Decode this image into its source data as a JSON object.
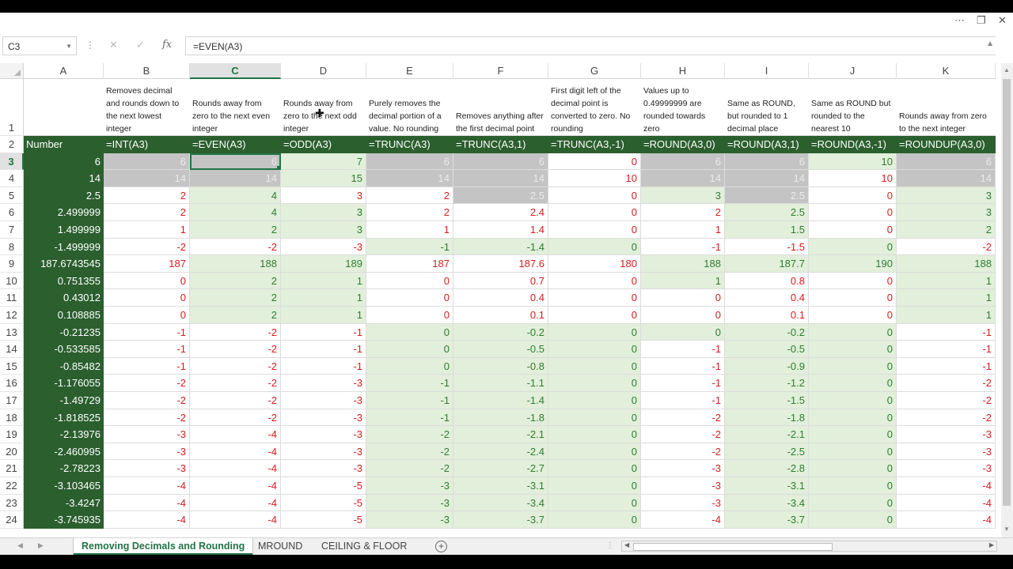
{
  "window": {
    "ribbon_dots": "⋯",
    "restore_icon": "❐",
    "close_icon": "✕"
  },
  "formula_bar": {
    "name_box": "C3",
    "cancel_icon": "✕",
    "enter_icon": "✓",
    "fx_label": "fx",
    "formula": "=EVEN(A3)"
  },
  "columns": [
    "A",
    "B",
    "C",
    "D",
    "E",
    "F",
    "G",
    "H",
    "I",
    "J",
    "K"
  ],
  "selected": {
    "col": "C",
    "row": 3
  },
  "descriptions": [
    "",
    "Removes decimal and rounds down to the next lowest integer",
    "Rounds away from zero to the next even integer",
    "Rounds away from zero to the next odd integer",
    "Purely removes the decimal portion of a value. No rounding",
    "Removes anything after the first decimal point",
    "First digit left of the decimal point is converted to zero. No rounding",
    "Values up to 0.49999999 are rounded towards zero",
    "Same as ROUND, but rounded to 1 decimal place",
    "Same as ROUND but rounded to the nearest 10",
    "Rounds away from zero to the next integer"
  ],
  "header_row": [
    "Number",
    "=INT(A3)",
    "=EVEN(A3)",
    "=ODD(A3)",
    "=TRUNC(A3)",
    "=TRUNC(A3,1)",
    "=TRUNC(A3,-1)",
    "=ROUND(A3,0)",
    "=ROUND(A3,1)",
    "=ROUND(A3,-1)",
    "=ROUNDUP(A3,0)"
  ],
  "rows": [
    [
      "6",
      "6",
      "6",
      "7",
      "6",
      "6",
      "0",
      "6",
      "6",
      "10",
      "6"
    ],
    [
      "14",
      "14",
      "14",
      "15",
      "14",
      "14",
      "10",
      "14",
      "14",
      "10",
      "14"
    ],
    [
      "2.5",
      "2",
      "4",
      "3",
      "2",
      "2.5",
      "0",
      "3",
      "2.5",
      "0",
      "3"
    ],
    [
      "2.499999",
      "2",
      "4",
      "3",
      "2",
      "2.4",
      "0",
      "2",
      "2.5",
      "0",
      "3"
    ],
    [
      "1.499999",
      "1",
      "2",
      "3",
      "1",
      "1.4",
      "0",
      "1",
      "1.5",
      "0",
      "2"
    ],
    [
      "-1.499999",
      "-2",
      "-2",
      "-3",
      "-1",
      "-1.4",
      "0",
      "-1",
      "-1.5",
      "0",
      "-2"
    ],
    [
      "187.6743545",
      "187",
      "188",
      "189",
      "187",
      "187.6",
      "180",
      "188",
      "187.7",
      "190",
      "188"
    ],
    [
      "0.751355",
      "0",
      "2",
      "1",
      "0",
      "0.7",
      "0",
      "1",
      "0.8",
      "0",
      "1"
    ],
    [
      "0.43012",
      "0",
      "2",
      "1",
      "0",
      "0.4",
      "0",
      "0",
      "0.4",
      "0",
      "1"
    ],
    [
      "0.108885",
      "0",
      "2",
      "1",
      "0",
      "0.1",
      "0",
      "0",
      "0.1",
      "0",
      "1"
    ],
    [
      "-0.21235",
      "-1",
      "-2",
      "-1",
      "0",
      "-0.2",
      "0",
      "0",
      "-0.2",
      "0",
      "-1"
    ],
    [
      "-0.533585",
      "-1",
      "-2",
      "-1",
      "0",
      "-0.5",
      "0",
      "-1",
      "-0.5",
      "0",
      "-1"
    ],
    [
      "-0.85482",
      "-1",
      "-2",
      "-1",
      "0",
      "-0.8",
      "0",
      "-1",
      "-0.9",
      "0",
      "-1"
    ],
    [
      "-1.176055",
      "-2",
      "-2",
      "-3",
      "-1",
      "-1.1",
      "0",
      "-1",
      "-1.2",
      "0",
      "-2"
    ],
    [
      "-1.49729",
      "-2",
      "-2",
      "-3",
      "-1",
      "-1.4",
      "0",
      "-1",
      "-1.5",
      "0",
      "-2"
    ],
    [
      "-1.818525",
      "-2",
      "-2",
      "-3",
      "-1",
      "-1.8",
      "0",
      "-2",
      "-1.8",
      "0",
      "-2"
    ],
    [
      "-2.13976",
      "-3",
      "-4",
      "-3",
      "-2",
      "-2.1",
      "0",
      "-2",
      "-2.1",
      "0",
      "-3"
    ],
    [
      "-2.460995",
      "-3",
      "-4",
      "-3",
      "-2",
      "-2.4",
      "0",
      "-2",
      "-2.5",
      "0",
      "-3"
    ],
    [
      "-2.78223",
      "-3",
      "-4",
      "-3",
      "-2",
      "-2.7",
      "0",
      "-3",
      "-2.8",
      "0",
      "-3"
    ],
    [
      "-3.103465",
      "-4",
      "-4",
      "-5",
      "-3",
      "-3.1",
      "0",
      "-3",
      "-3.1",
      "0",
      "-4"
    ],
    [
      "-3.4247",
      "-4",
      "-4",
      "-5",
      "-3",
      "-3.4",
      "0",
      "-3",
      "-3.4",
      "0",
      "-4"
    ],
    [
      "-3.745935",
      "-4",
      "-4",
      "-5",
      "-3",
      "-3.7",
      "0",
      "-4",
      "-3.7",
      "0",
      "-4"
    ]
  ],
  "cell_styles": [
    "AxxgxxrxxgxZ",
    "Axxgxxrxxrx",
    "Argrrxrgxrg",
    "Arggrrrrgrg",
    "Arggrrrrgrg",
    "Arrrgggrrgr",
    "Arggrrrgggg",
    "Arggrrrgrrg",
    "Arggrrrrrrg",
    "Arggrrrrrrg",
    "Arrrgggggg r",
    "Arrrgggrggr",
    "Arrrgggrggr",
    "Arrrgggrggr",
    "Arrrgggrggr",
    "Arrrgggrggr",
    "Arrrgggrggr",
    "Arrrgggrggr",
    "Arrrgggrggr",
    "Arrrgggrggr",
    "Arrrgggrggr",
    "Arrrgggrggr"
  ],
  "sheet_tabs": [
    "Removing Decimals and Rounding",
    "MROUND",
    "CEILING & FLOOR"
  ],
  "active_tab": 0,
  "add_sheet": "+"
}
